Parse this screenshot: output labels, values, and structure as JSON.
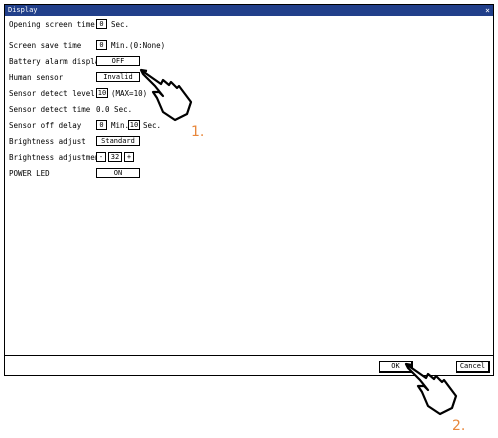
{
  "window": {
    "title": "Display",
    "close_glyph": "×"
  },
  "rows": {
    "opening_screen_time": {
      "label": "Opening screen time",
      "value": "0",
      "unit": "Sec."
    },
    "screen_save_time": {
      "label": "Screen save time",
      "value": "0",
      "unit": "Min.(0:None)"
    },
    "battery_alarm_display": {
      "label": "Battery alarm display",
      "value": "OFF"
    },
    "human_sensor": {
      "label": "Human sensor",
      "value": "Invalid"
    },
    "sensor_detect_level": {
      "label": "Sensor detect level",
      "value": "10",
      "unit": "(MAX=10)"
    },
    "sensor_detect_time": {
      "label": "Sensor detect time",
      "value": "0.0 Sec."
    },
    "sensor_off_delay": {
      "label": "Sensor off delay",
      "value_min": "0",
      "unit_min": "Min.",
      "value_sec": "10",
      "unit_sec": "Sec."
    },
    "brightness_adjust": {
      "label": "Brightness adjust",
      "value": "Standard"
    },
    "brightness_adjustment": {
      "label": "Brightness adjustment",
      "minus": "-",
      "value": "32",
      "plus": "+"
    },
    "power_led": {
      "label": "POWER LED",
      "value": "ON"
    }
  },
  "buttons": {
    "ok": "OK",
    "cancel": "Cancel"
  },
  "callouts": {
    "first": "1.",
    "second": "2."
  },
  "colors": {
    "titlebar": "#213f8a",
    "callout": "#e8873b"
  }
}
